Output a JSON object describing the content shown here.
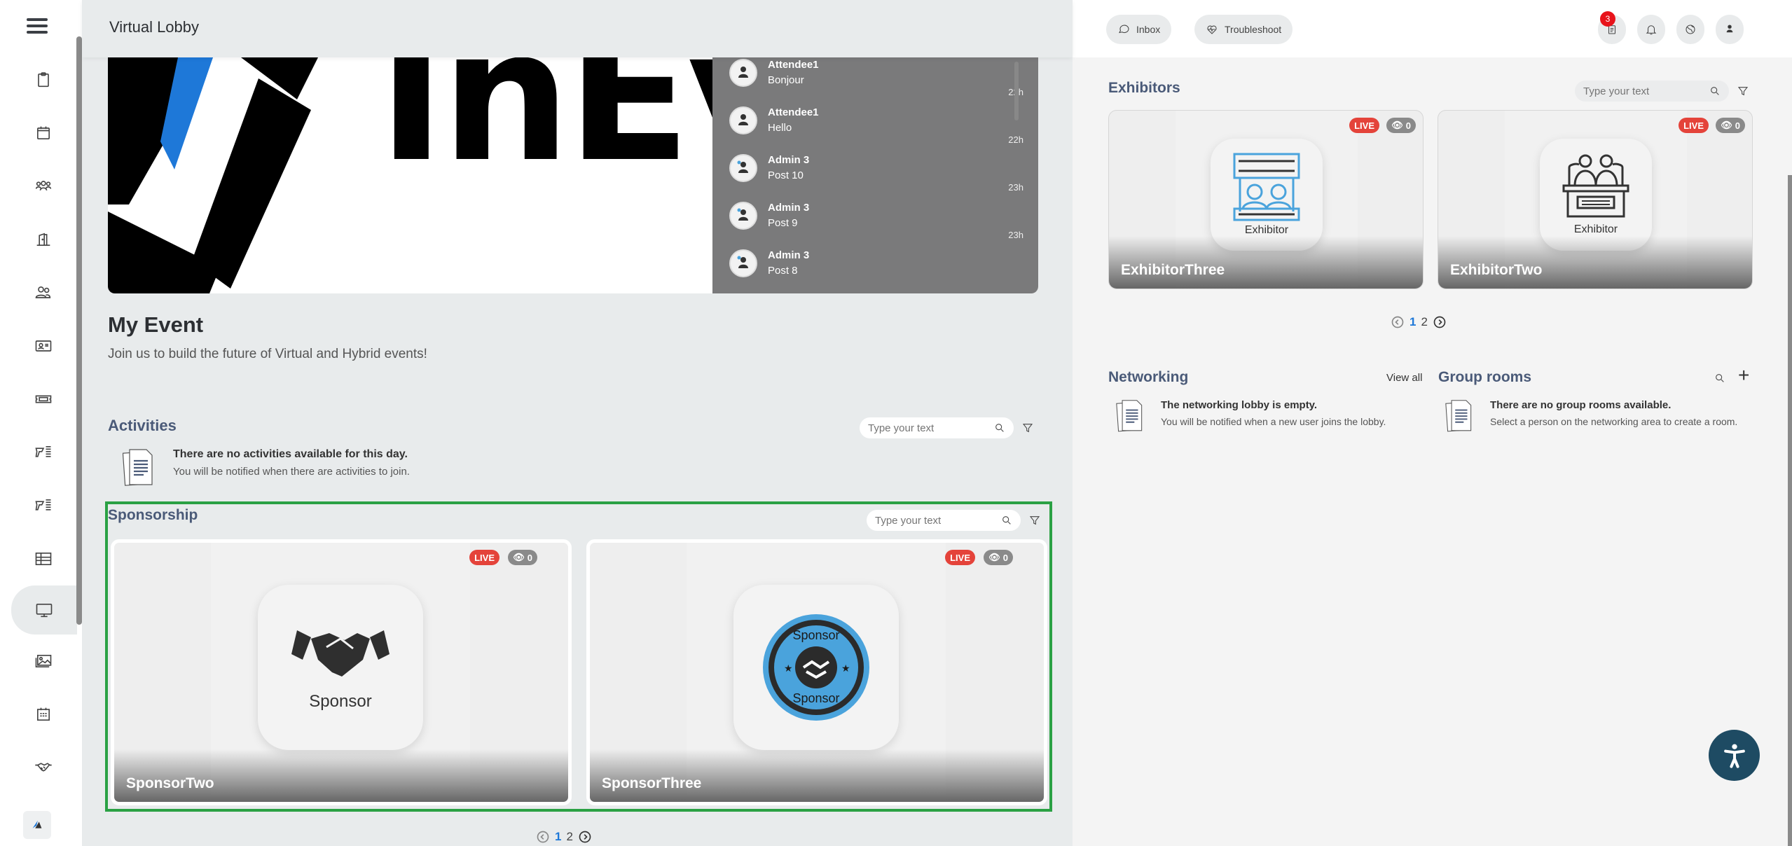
{
  "app": {
    "title": "Virtual Lobby"
  },
  "sidebar": {
    "menu_icon": "hamburger-icon",
    "items": [
      {
        "icon": "clipboard-icon",
        "label": "Agenda"
      },
      {
        "icon": "calendar-icon",
        "label": "Calendar"
      },
      {
        "icon": "group-icon",
        "label": "Attendees"
      },
      {
        "icon": "door-icon",
        "label": "Rooms"
      },
      {
        "icon": "users-icon",
        "label": "Networking"
      },
      {
        "icon": "id-card-icon",
        "label": "Profile"
      },
      {
        "icon": "ticket-icon",
        "label": "Tickets"
      },
      {
        "icon": "scanner-icon",
        "label": "Scanner"
      },
      {
        "icon": "scanner-icon",
        "label": "Scanner 2"
      },
      {
        "icon": "table-icon",
        "label": "Table"
      },
      {
        "icon": "monitor-icon",
        "label": "Virtual Lobby",
        "active": true
      },
      {
        "icon": "gallery-icon",
        "label": "Gallery"
      },
      {
        "icon": "calendar-grid-icon",
        "label": "Schedule"
      },
      {
        "icon": "handshake-icon",
        "label": "Sponsors"
      }
    ]
  },
  "banner": {
    "logo_text": "InEve",
    "feed": [
      {
        "name": "Attendee1",
        "message": "Bonjour",
        "time": "22h",
        "role": "attendee"
      },
      {
        "name": "Attendee1",
        "message": "Hello",
        "time": "22h",
        "role": "attendee"
      },
      {
        "name": "Admin 3",
        "message": "Post 10",
        "time": "23h",
        "role": "admin"
      },
      {
        "name": "Admin 3",
        "message": "Post 9",
        "time": "23h",
        "role": "admin"
      },
      {
        "name": "Admin 3",
        "message": "Post 8",
        "time": "",
        "role": "admin"
      }
    ]
  },
  "event": {
    "title": "My Event",
    "subtitle": "Join us to build the future of Virtual and Hybrid events!"
  },
  "activities": {
    "title": "Activities",
    "search_placeholder": "Type your text",
    "empty_title": "There are no activities available for this day.",
    "empty_text": "You will be notified when there are activities to join."
  },
  "sponsorship": {
    "title": "Sponsorship",
    "search_placeholder": "Type your text",
    "cards": [
      {
        "name": "SponsorTwo",
        "tile_label": "Sponsor",
        "live": "LIVE",
        "views": "0"
      },
      {
        "name": "SponsorThree",
        "tile_label": "",
        "live": "LIVE",
        "views": "0"
      }
    ],
    "pager": {
      "current": "1",
      "pages": [
        "1",
        "2"
      ]
    }
  },
  "topbar_right": {
    "inbox": "Inbox",
    "troubleshoot": "Troubleshoot",
    "notification_count": "3"
  },
  "exhibitors": {
    "title": "Exhibitors",
    "search_placeholder": "Type your text",
    "cards": [
      {
        "name": "ExhibitorThree",
        "tile_label": "Exhibitor",
        "live": "LIVE",
        "views": "0"
      },
      {
        "name": "ExhibitorTwo",
        "tile_label": "Exhibitor",
        "live": "LIVE",
        "views": "0"
      }
    ],
    "pager": {
      "current": "1",
      "pages": [
        "1",
        "2"
      ]
    }
  },
  "networking": {
    "title": "Networking",
    "view_all": "View all",
    "empty_title": "The networking lobby is empty.",
    "empty_text": "You will be notified when a new user joins the lobby."
  },
  "group_rooms": {
    "title": "Group rooms",
    "empty_title": "There are no group rooms available.",
    "empty_text": "Select a person on the networking area to create a room."
  },
  "colors": {
    "accent_green": "#2aa144",
    "live_red": "#e4433a",
    "link_blue": "#1e78d8",
    "section_title": "#4a5a78",
    "a11y_button": "#1e4b63"
  }
}
